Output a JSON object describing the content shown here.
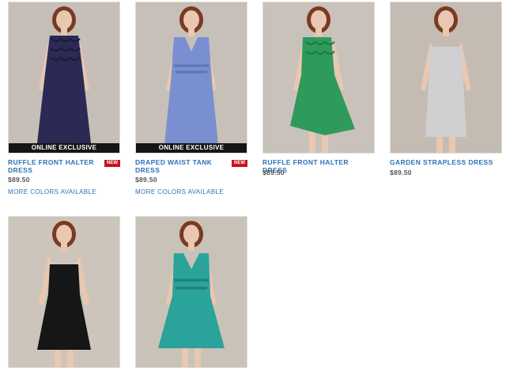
{
  "products": [
    {
      "name": "RUFFLE FRONT HALTER DRESS",
      "price": "$89.50",
      "exclusive": "ONLINE EXCLUSIVE",
      "badge": "NEW",
      "more": "MORE COLORS AVAILABLE",
      "dress_color": "#2b2a55",
      "bg": "#c6bfb7",
      "image": "model-navy-ruffle-halter-dress"
    },
    {
      "name": "DRAPED WAIST TANK DRESS",
      "price": "$89.50",
      "exclusive": "ONLINE EXCLUSIVE",
      "badge": "NEW",
      "more": "MORE COLORS AVAILABLE",
      "dress_color": "#7a8fd0",
      "bg": "#c7c0b8",
      "image": "model-periwinkle-draped-tank-dress"
    },
    {
      "name": "RUFFLE FRONT HALTER DRESS",
      "price": "$89.50",
      "dress_color": "#2e9a5c",
      "bg": "#c9c2ba",
      "image": "model-green-ruffle-halter-dress"
    },
    {
      "name": "GARDEN STRAPLESS DRESS",
      "price": "$89.50",
      "dress_color": "#d0d0d2",
      "bg": "#c4bcb2",
      "image": "model-silver-strapless-dress"
    },
    {
      "dress_color": "#161616",
      "bg": "#cdc5bb",
      "image": "model-black-strapless-dress"
    },
    {
      "dress_color": "#2aa39a",
      "bg": "#c9c2b9",
      "image": "model-teal-draped-dress"
    }
  ]
}
